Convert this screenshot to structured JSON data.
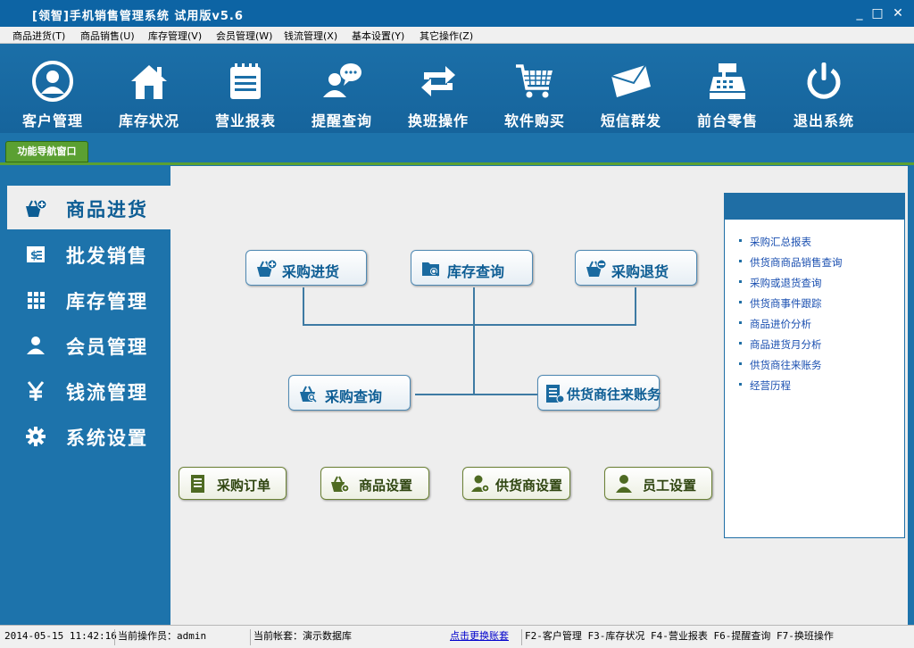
{
  "window": {
    "title": "[领智]手机销售管理系统 试用版v5.6",
    "min": "_",
    "max": "□",
    "close": "✕"
  },
  "menu": [
    "商品进货(T)",
    "商品销售(U)",
    "库存管理(V)",
    "会员管理(W)",
    "钱流管理(X)",
    "基本设置(Y)",
    "其它操作(Z)"
  ],
  "toolbar": [
    {
      "label": "客户管理",
      "icon": "user-circle-icon"
    },
    {
      "label": "库存状况",
      "icon": "house-icon"
    },
    {
      "label": "营业报表",
      "icon": "notepad-icon"
    },
    {
      "label": "提醒查询",
      "icon": "chat-user-icon"
    },
    {
      "label": "换班操作",
      "icon": "swap-arrows-icon"
    },
    {
      "label": "软件购买",
      "icon": "shopping-cart-icon"
    },
    {
      "label": "短信群发",
      "icon": "envelope-icon"
    },
    {
      "label": "前台零售",
      "icon": "cash-register-icon"
    },
    {
      "label": "退出系统",
      "icon": "power-icon"
    }
  ],
  "nav_tab": "功能导航窗口",
  "left_nav": [
    {
      "label": "商品进货",
      "icon": "basket-plus-icon",
      "active": true
    },
    {
      "label": "批发销售",
      "icon": "invoice-icon",
      "active": false
    },
    {
      "label": "库存管理",
      "icon": "grid-icon",
      "active": false
    },
    {
      "label": "会员管理",
      "icon": "person-icon",
      "active": false
    },
    {
      "label": "钱流管理",
      "icon": "yen-icon",
      "active": false
    },
    {
      "label": "系统设置",
      "icon": "gear-icon",
      "active": false
    }
  ],
  "flow": {
    "purchase_in": "采购进货",
    "stock_query": "库存查询",
    "purchase_return": "采购退货",
    "purchase_query": "采购查询",
    "supplier_account": "供货商往来账务"
  },
  "bottom_buttons": {
    "purchase_order": "采购订单",
    "goods_setting": "商品设置",
    "supplier_setting": "供货商设置",
    "staff_setting": "员工设置"
  },
  "right_links": [
    "采购汇总报表",
    "供货商商品销售查询",
    "采购或退货查询",
    "供货商事件跟踪",
    "商品进价分析",
    "商品进货月分析",
    "供货商往来账务",
    "经营历程"
  ],
  "status": {
    "datetime": "2014-05-15 11:42:16",
    "operator": "当前操作员：admin",
    "account": "当前帐套：演示数据库",
    "switch_link": "点击更换账套",
    "shortcuts": "F2-客户管理 F3-库存状况 F4-营业报表 F6-提醒查询 F7-换班操作"
  },
  "colors": {
    "titlebar": "#0d64a4",
    "toolbar": "#1b6fa8",
    "nav_green": "#5ba032",
    "accent": "#0d5d94"
  }
}
